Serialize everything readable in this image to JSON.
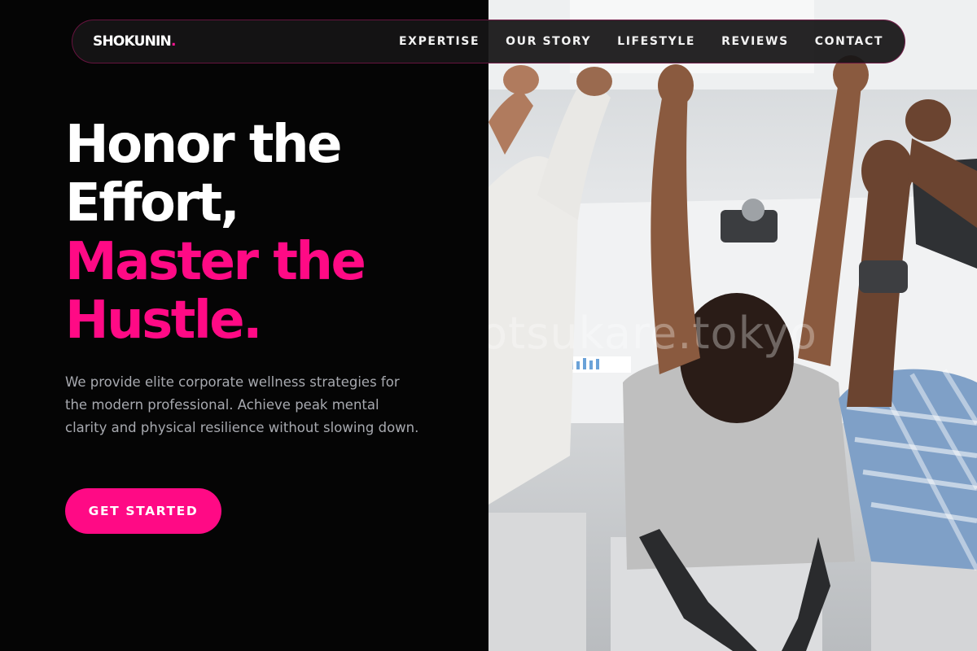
{
  "brand": {
    "name": "SHOKUNIN",
    "dot": ".",
    "accent_color": "#ff0a85"
  },
  "nav": {
    "items": [
      {
        "label": "EXPERTISE"
      },
      {
        "label": "OUR STORY"
      },
      {
        "label": "LIFESTYLE"
      },
      {
        "label": "REVIEWS"
      },
      {
        "label": "CONTACT"
      }
    ]
  },
  "hero": {
    "headline_white_1": "Honor the",
    "headline_white_2": "Effort,",
    "headline_pink_1": "Master the",
    "headline_pink_2": "Hustle.",
    "description": "We provide elite corporate wellness strategies for the modern professional. Achieve peak mental clarity and physical resilience without slowing down.",
    "cta_label": "GET STARTED"
  },
  "photo": {
    "watermark": "otsukare.tokyo"
  }
}
